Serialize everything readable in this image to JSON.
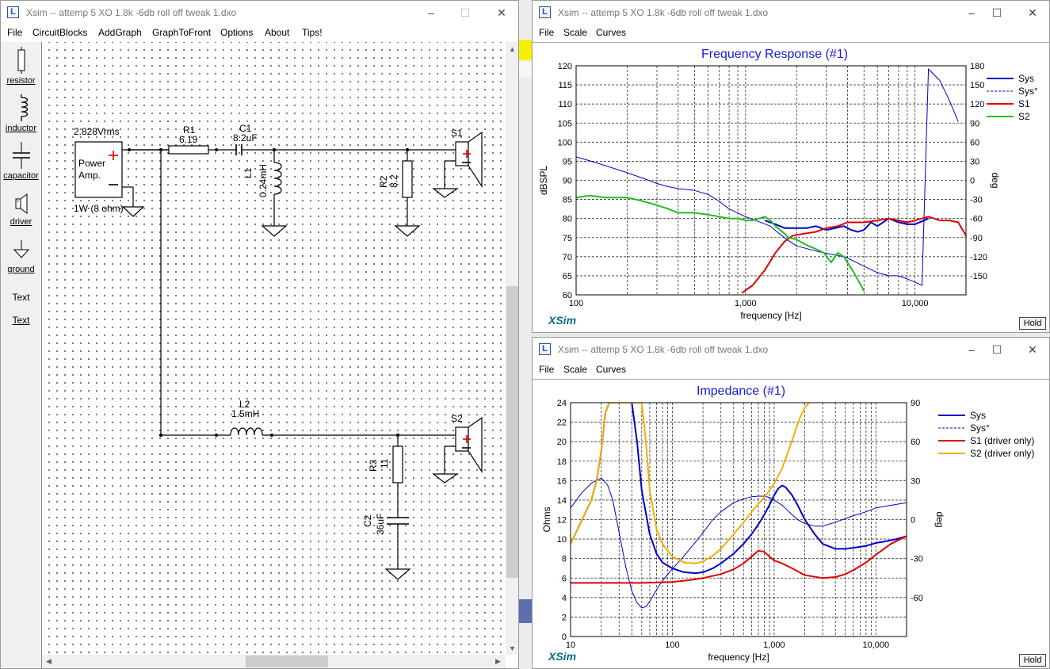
{
  "schematic_window": {
    "title": "Xsim -- attemp 5 XO 1.8k -6db roll off tweak 1.dxo",
    "menu": [
      "File",
      "CircuitBlocks",
      "AddGraph",
      "GraphToFront",
      "Options",
      "About",
      "Tips!"
    ],
    "tools": [
      {
        "label": "resistor",
        "icon": "resistor-icon"
      },
      {
        "label": "inductor",
        "icon": "inductor-icon"
      },
      {
        "label": "capacitor",
        "icon": "capacitor-icon"
      },
      {
        "label": "driver",
        "icon": "driver-icon"
      },
      {
        "label": "ground",
        "icon": "ground-icon"
      },
      {
        "label": "Text",
        "icon": "text-icon"
      },
      {
        "label": "Text",
        "icon": "text-link"
      }
    ],
    "components": {
      "amp_voltage": "2.828Vrms",
      "amp_name": "Power Amp.",
      "amp_power": "1W (8 ohm)",
      "r1_name": "R1",
      "r1_value": "6.19",
      "c1_name": "C1",
      "c1_value": "8.2uF",
      "l1_name": "L1",
      "l1_value": "0.24mH",
      "r2_name": "R2",
      "r2_value": "8.2",
      "s1_name": "S1",
      "l2_name": "L2",
      "l2_value": "1.5mH",
      "s2_name": "S2",
      "r3_name": "R3",
      "r3_value": "11",
      "c2_name": "C2",
      "c2_value": "36uF"
    }
  },
  "freq_window": {
    "title": "Xsim -- attemp 5 XO 1.8k -6db roll off tweak 1.dxo",
    "menu": [
      "File",
      "Scale",
      "Curves"
    ],
    "logo": "XSim",
    "hold": "Hold",
    "chart_data": {
      "type": "line",
      "title": "Frequency Response (#1)",
      "xlabel": "frequency [Hz]",
      "ylabel": "dBSPL",
      "y2label": "deg",
      "xscale": "log",
      "xlim": [
        100,
        20000
      ],
      "ylim": [
        60,
        120
      ],
      "y2lim": [
        -180,
        180
      ],
      "xticks": [
        "100",
        "1,000",
        "10,000"
      ],
      "yticks": [
        "60",
        "65",
        "70",
        "75",
        "80",
        "85",
        "90",
        "95",
        "100",
        "105",
        "110",
        "115",
        "120"
      ],
      "y2ticks": [
        "-150",
        "-120",
        "-90",
        "-60",
        "-30",
        "0",
        "30",
        "60",
        "90",
        "120",
        "150",
        "180"
      ],
      "legend_position": "right",
      "legend": [
        {
          "name": "Sys",
          "color": "#0000c8",
          "style": "solid"
        },
        {
          "name": "Sys°",
          "color": "#0000c8",
          "style": "dashed"
        },
        {
          "name": "S1",
          "color": "#e00000",
          "style": "solid"
        },
        {
          "name": "S2",
          "color": "#1ec01e",
          "style": "solid"
        }
      ],
      "series": [
        {
          "name": "Sys",
          "axis": "y",
          "color": "#0000c8",
          "width": 2,
          "x": [
            1300,
            1500,
            1700,
            2000,
            2300,
            2600,
            3000,
            3400,
            3800,
            4200,
            4600,
            5000,
            5500,
            6000,
            7000,
            8000,
            9000,
            10000,
            12000
          ],
          "y": [
            79.5,
            78.5,
            77.5,
            77.5,
            77.5,
            78,
            77,
            77.5,
            78,
            77,
            76.5,
            77,
            79,
            78,
            80,
            79,
            78.5,
            78.5,
            80
          ]
        },
        {
          "name": "Sys°",
          "axis": "y2",
          "color": "#0000c8",
          "width": 1,
          "x": [
            100,
            130,
            170,
            200,
            250,
            300,
            350,
            400,
            500,
            600,
            700,
            800,
            1000,
            1200,
            1400,
            1600,
            1800,
            2000,
            2500,
            3000,
            3500,
            4000,
            5000,
            6000,
            7000,
            8000,
            9000,
            10000,
            11000,
            12000,
            14000,
            16000,
            18000
          ],
          "y": [
            37,
            28,
            18,
            12,
            3,
            -5,
            -10,
            -13,
            -16,
            -22,
            -33,
            -45,
            -57,
            -65,
            -72,
            -85,
            -95,
            -103,
            -110,
            -115,
            -118,
            -122,
            -135,
            -145,
            -150,
            -150,
            -155,
            -160,
            -165,
            175,
            157,
            125,
            92
          ]
        },
        {
          "name": "S1",
          "axis": "y",
          "color": "#e00000",
          "width": 2,
          "x": [
            950,
            1100,
            1300,
            1500,
            1700,
            1900,
            2200,
            2600,
            3000,
            3500,
            4000,
            5000,
            6000,
            7000,
            8000,
            9000,
            10000,
            12000,
            14000,
            16000,
            18000,
            20000
          ],
          "y": [
            60.5,
            62.5,
            66.5,
            71,
            74,
            75.5,
            76,
            76.5,
            77.5,
            78,
            79,
            79,
            79.5,
            80,
            79.5,
            79,
            79.5,
            80.5,
            79.5,
            79.5,
            79,
            75.5
          ]
        },
        {
          "name": "S2",
          "axis": "y",
          "color": "#1ec01e",
          "width": 2,
          "x": [
            100,
            120,
            150,
            200,
            250,
            300,
            350,
            400,
            450,
            500,
            600,
            700,
            800,
            900,
            1000,
            1100,
            1200,
            1300,
            1400,
            1500,
            1600,
            1700,
            1800,
            2000,
            2300,
            2600,
            2900,
            3200,
            3500,
            3800,
            4200,
            4600,
            5000
          ],
          "y": [
            85.5,
            86,
            85.5,
            85.5,
            84.5,
            83.5,
            82.5,
            81.5,
            81.5,
            81.5,
            81,
            80.5,
            80,
            80,
            79.5,
            79.5,
            80,
            80.5,
            79.5,
            78,
            77,
            76,
            75,
            74.5,
            73,
            72,
            71,
            68.5,
            71,
            70,
            67,
            64,
            61
          ]
        }
      ]
    }
  },
  "imp_window": {
    "title": "Xsim -- attemp 5 XO 1.8k -6db roll off tweak 1.dxo",
    "menu": [
      "File",
      "Scale",
      "Curves"
    ],
    "logo": "XSim",
    "hold": "Hold",
    "chart_data": {
      "type": "line",
      "title": "Impedance (#1)",
      "xlabel": "frequency [Hz]",
      "ylabel": "Ohms",
      "y2label": "deg",
      "xscale": "log",
      "xlim": [
        10,
        20000
      ],
      "ylim": [
        0,
        24
      ],
      "y2lim": [
        -90,
        90
      ],
      "xticks": [
        "10",
        "100",
        "1,000",
        "10,000"
      ],
      "yticks": [
        "0",
        "2",
        "4",
        "6",
        "8",
        "10",
        "12",
        "14",
        "16",
        "18",
        "20",
        "22",
        "24"
      ],
      "y2ticks": [
        "-60",
        "-30",
        "0",
        "30",
        "60",
        "90"
      ],
      "legend_position": "right",
      "legend": [
        {
          "name": "Sys",
          "color": "#0000c8",
          "style": "solid"
        },
        {
          "name": "Sys°",
          "color": "#0000c8",
          "style": "dashed"
        },
        {
          "name": "S1 (driver only)",
          "color": "#e00000",
          "style": "solid"
        },
        {
          "name": "S2 (driver only)",
          "color": "#f0b000",
          "style": "solid"
        }
      ],
      "series": [
        {
          "name": "Sys",
          "axis": "y",
          "color": "#0000c8",
          "width": 2,
          "x": [
            10,
            13,
            16,
            18,
            20,
            22,
            24,
            25,
            40,
            45,
            50,
            60,
            70,
            80,
            100,
            130,
            170,
            200,
            250,
            300,
            400,
            500,
            600,
            700,
            800,
            900,
            1000,
            1100,
            1200,
            1300,
            1500,
            1700,
            2000,
            2500,
            3000,
            4000,
            5000,
            6000,
            8000,
            10000,
            13000,
            16000,
            20000
          ],
          "y": [
            9.5,
            12,
            14,
            16,
            19,
            23,
            24,
            24,
            24,
            20,
            15,
            10.5,
            8.5,
            7.6,
            7.0,
            6.6,
            6.5,
            6.6,
            7.0,
            7.5,
            8.5,
            9.5,
            10.5,
            11.5,
            12.5,
            13.5,
            14.5,
            15.2,
            15.5,
            15.3,
            14.5,
            13.5,
            12,
            10.5,
            9.5,
            9.0,
            9.0,
            9.1,
            9.3,
            9.6,
            9.8,
            10.0,
            10.3
          ]
        },
        {
          "name": "Sys°",
          "axis": "y2",
          "color": "#0000c8",
          "width": 1,
          "x": [
            10,
            13,
            16,
            20,
            23,
            26,
            30,
            35,
            40,
            45,
            50,
            55,
            60,
            70,
            80,
            100,
            130,
            170,
            200,
            250,
            300,
            400,
            500,
            600,
            700,
            800,
            900,
            1000,
            1200,
            1400,
            1700,
            2000,
            2500,
            3000,
            4000,
            6000,
            8000,
            10000,
            14000,
            20000
          ],
          "y": [
            9,
            21,
            28,
            32,
            27,
            15,
            -10,
            -37,
            -55,
            -64,
            -68,
            -67,
            -63,
            -54,
            -47,
            -38,
            -28,
            -17,
            -10,
            0,
            6,
            13,
            16,
            17.5,
            18,
            18,
            17,
            15,
            11,
            6,
            0,
            -3,
            -5,
            -5,
            -2,
            3,
            6,
            9,
            11,
            13
          ]
        },
        {
          "name": "S1 (driver only)",
          "axis": "y",
          "color": "#e00000",
          "width": 2,
          "x": [
            10,
            20,
            50,
            100,
            150,
            200,
            300,
            400,
            500,
            600,
            700,
            800,
            900,
            1000,
            1200,
            1500,
            2000,
            3000,
            4000,
            5000,
            6000,
            8000,
            10000,
            14000,
            20000
          ],
          "y": [
            5.5,
            5.5,
            5.5,
            5.6,
            5.8,
            6.0,
            6.4,
            6.9,
            7.5,
            8.2,
            8.8,
            8.7,
            8.2,
            7.8,
            7.5,
            7.0,
            6.3,
            6.0,
            6.1,
            6.4,
            6.8,
            7.6,
            8.4,
            9.5,
            10.3
          ]
        },
        {
          "name": "S2 (driver only)",
          "axis": "y",
          "color": "#f0b000",
          "width": 2,
          "x": [
            10,
            13,
            16,
            18,
            20,
            22,
            24,
            25,
            50,
            55,
            60,
            70,
            80,
            100,
            130,
            170,
            200,
            250,
            300,
            400,
            500,
            600,
            700,
            800,
            900,
            1000,
            1200,
            1400,
            1600,
            1800,
            2000,
            2200
          ],
          "y": [
            9.5,
            12,
            14,
            16,
            19,
            23,
            24,
            24,
            24,
            20,
            15,
            11,
            9.5,
            8.2,
            7.6,
            7.5,
            7.7,
            8.3,
            9.0,
            10.5,
            11.7,
            12.8,
            13.6,
            14.3,
            15,
            15.7,
            17.3,
            19.2,
            21,
            22.5,
            23.5,
            24
          ]
        }
      ]
    }
  }
}
